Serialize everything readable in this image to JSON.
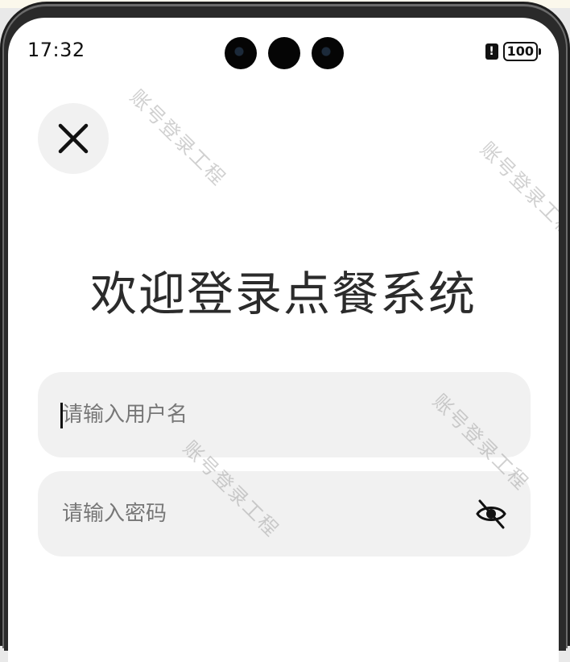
{
  "status_bar": {
    "time": "17:32",
    "alert_glyph": "!",
    "battery_level": "100"
  },
  "close_button": {
    "icon": "close-icon"
  },
  "login": {
    "title": "欢迎登录点餐系统",
    "username_placeholder": "请输入用户名",
    "username_value": "",
    "password_placeholder": "请输入密码",
    "password_value": "",
    "password_toggle_icon": "eye-off-icon"
  },
  "watermark": {
    "text": "账号登录工程"
  }
}
